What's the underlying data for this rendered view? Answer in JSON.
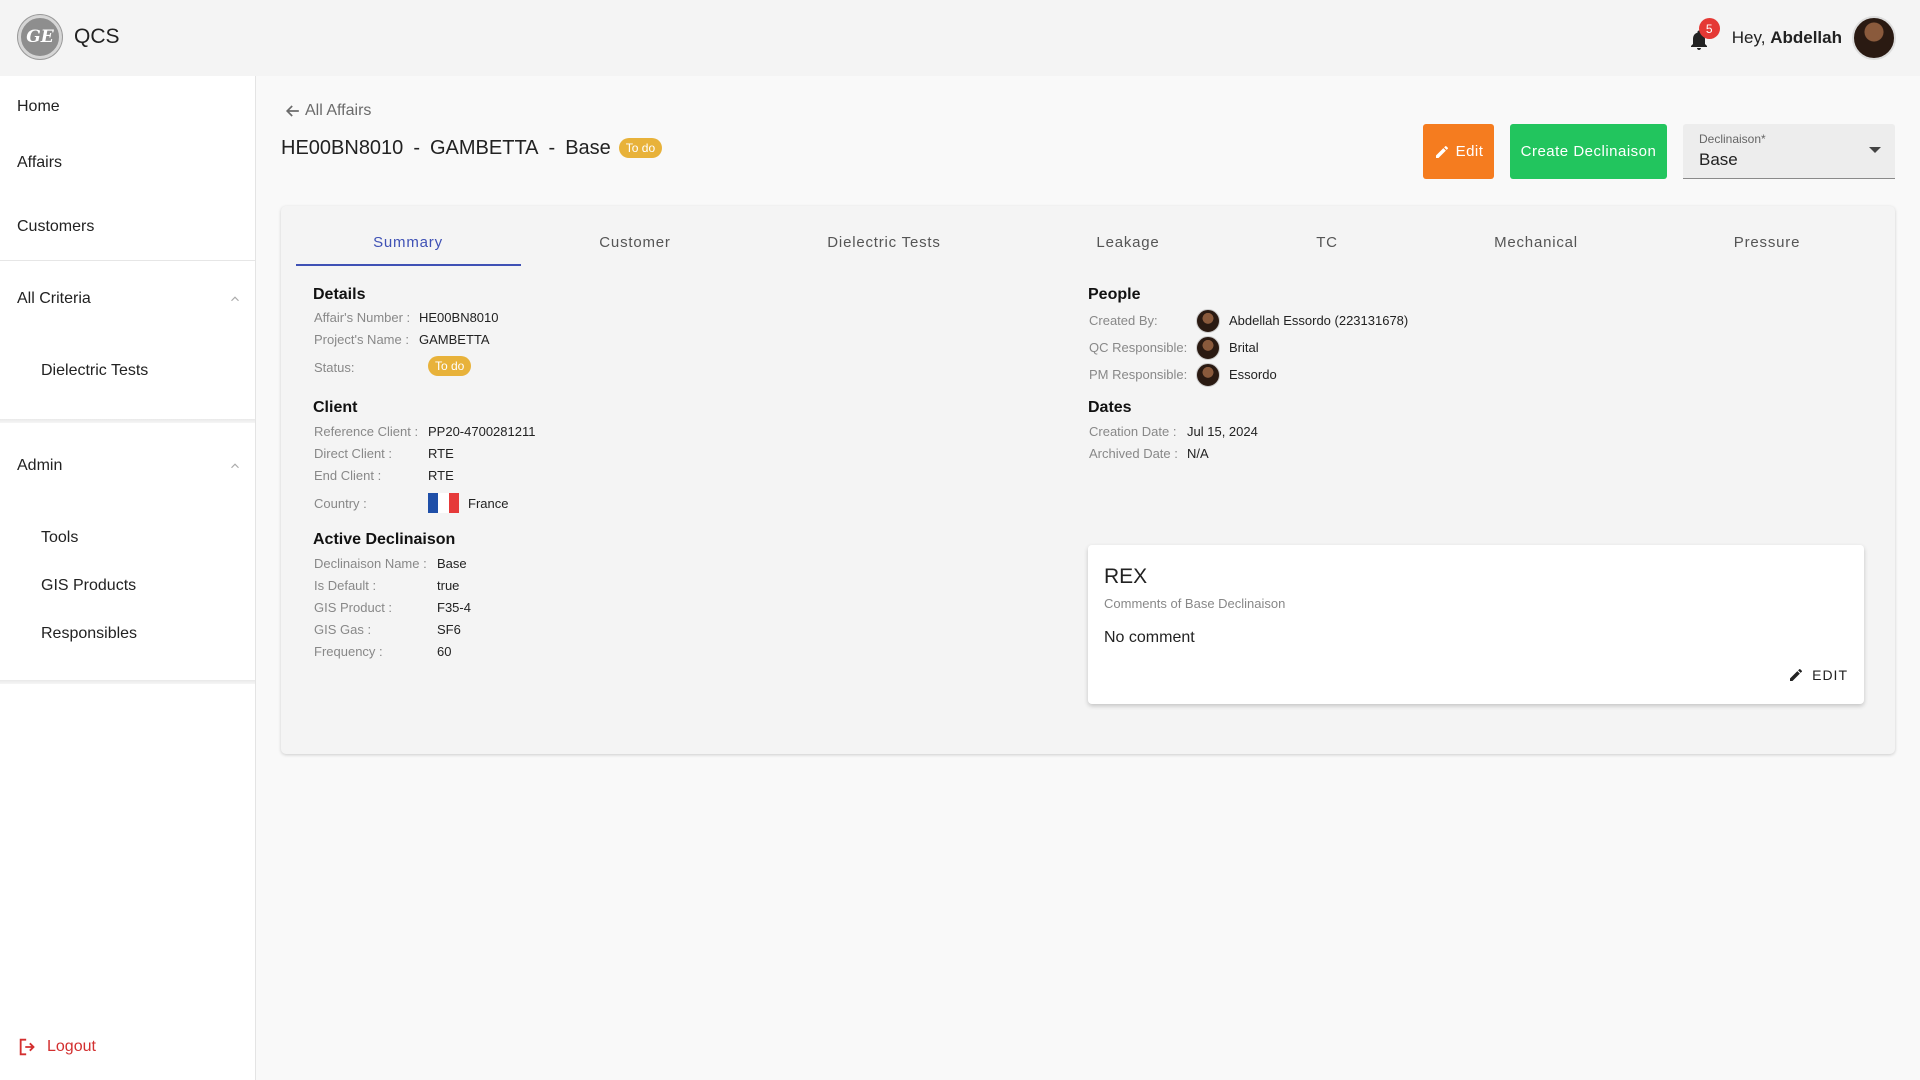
{
  "app": {
    "logo_text": "GE",
    "title": "QCS"
  },
  "user": {
    "greeting": "Hey,",
    "name": "Abdellah",
    "notification_count": "5"
  },
  "sidebar": {
    "home": "Home",
    "affairs": "Affairs",
    "customers": "Customers",
    "all_criteria": "All Criteria",
    "dielectric_tests": "Dielectric Tests",
    "admin": "Admin",
    "tools": "Tools",
    "gis_products": "GIS Products",
    "responsibles": "Responsibles",
    "logout": "Logout"
  },
  "header": {
    "back_label": "All Affairs",
    "affair_number": "HE00BN8010",
    "project": "GAMBETTA",
    "declinaison": "Base",
    "separator": "-",
    "status_chip": "To do"
  },
  "actions": {
    "edit_label": "Edit",
    "create_label": "Create Declinaison",
    "select_label": "Declinaison*",
    "select_value": "Base"
  },
  "tabs": [
    "Summary",
    "Customer",
    "Dielectric Tests",
    "Leakage",
    "TC",
    "Mechanical",
    "Pressure"
  ],
  "details": {
    "title": "Details",
    "affair_number_label": "Affair's Number :",
    "affair_number": "HE00BN8010",
    "project_name_label": "Project's Name :",
    "project_name": "GAMBETTA",
    "status_label": "Status:",
    "status": "To do"
  },
  "client": {
    "title": "Client",
    "reference_label": "Reference Client :",
    "reference": "PP20-4700281211",
    "direct_label": "Direct Client :",
    "direct": "RTE",
    "end_label": "End Client :",
    "end": "RTE",
    "country_label": "Country :",
    "country": "France",
    "flag_colors": [
      "#1f4fa8",
      "#ffffff",
      "#e63a3a"
    ]
  },
  "active_declinaison": {
    "title": "Active Declinaison",
    "name_label": "Declinaison Name :",
    "name": "Base",
    "default_label": "Is Default :",
    "default": "true",
    "gis_product_label": "GIS Product :",
    "gis_product": "F35-4",
    "gis_gas_label": "GIS Gas :",
    "gis_gas": "SF6",
    "frequency_label": "Frequency :",
    "frequency": "60"
  },
  "people": {
    "title": "People",
    "created_by_label": "Created By:",
    "created_by": "Abdellah Essordo (223131678)",
    "qc_label": "QC Responsible:",
    "qc": "Brital",
    "pm_label": "PM Responsible:",
    "pm": "Essordo"
  },
  "dates": {
    "title": "Dates",
    "creation_label": "Creation Date :",
    "creation": "Jul 15, 2024",
    "archived_label": "Archived Date :",
    "archived": "N/A"
  },
  "rex": {
    "title": "REX",
    "subtitle": "Comments of Base Declinaison",
    "body": "No comment",
    "edit_label": "EDIT"
  },
  "colors": {
    "accent": "#3f51b5",
    "edit_button": "#f57c1f",
    "create_button": "#22c55e",
    "status_chip": "#e8b23a",
    "logout": "#d32f2f",
    "badge": "#e53935"
  },
  "icons": {
    "logo": "ge-logo-icon",
    "bell": "bell-icon",
    "back": "arrow-left-icon",
    "edit": "pencil-icon",
    "dropdown": "caret-down-icon",
    "collapse": "chevron-up-icon",
    "logout": "logout-icon"
  }
}
